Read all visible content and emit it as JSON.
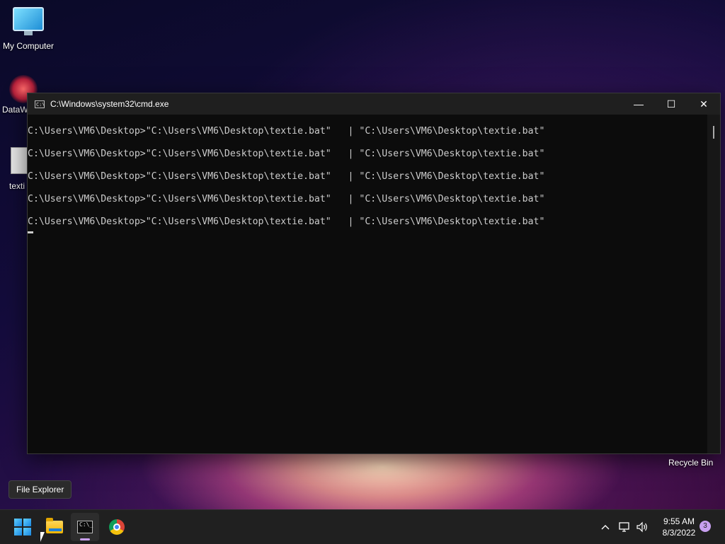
{
  "desktop": {
    "icons": [
      {
        "label": "My Computer",
        "icon": "monitor-icon"
      },
      {
        "label": "DataW",
        "icon": "datawatch-icon"
      },
      {
        "label": "texti",
        "icon": "batch-file-icon"
      }
    ],
    "recycle_bin": "Recycle Bin"
  },
  "window": {
    "title": "C:\\Windows\\system32\\cmd.exe",
    "controls": {
      "minimize": "—",
      "maximize": "☐",
      "close": "✕"
    },
    "lines": [
      "C:\\Users\\VM6\\Desktop>\"C:\\Users\\VM6\\Desktop\\textie.bat\"   | \"C:\\Users\\VM6\\Desktop\\textie.bat\"",
      "C:\\Users\\VM6\\Desktop>\"C:\\Users\\VM6\\Desktop\\textie.bat\"   | \"C:\\Users\\VM6\\Desktop\\textie.bat\"",
      "C:\\Users\\VM6\\Desktop>\"C:\\Users\\VM6\\Desktop\\textie.bat\"   | \"C:\\Users\\VM6\\Desktop\\textie.bat\"",
      "C:\\Users\\VM6\\Desktop>\"C:\\Users\\VM6\\Desktop\\textie.bat\"   | \"C:\\Users\\VM6\\Desktop\\textie.bat\"",
      "C:\\Users\\VM6\\Desktop>\"C:\\Users\\VM6\\Desktop\\textie.bat\"   | \"C:\\Users\\VM6\\Desktop\\textie.bat\""
    ]
  },
  "tooltip": "File Explorer",
  "taskbar": {
    "apps": [
      "start-icon",
      "file-explorer-icon",
      "command-prompt-icon",
      "chrome-icon"
    ],
    "tray": {
      "chevron": "^",
      "network": "network-icon",
      "volume": "volume-icon"
    },
    "time": "9:55 AM",
    "date": "8/3/2022",
    "notification_count": "3"
  }
}
